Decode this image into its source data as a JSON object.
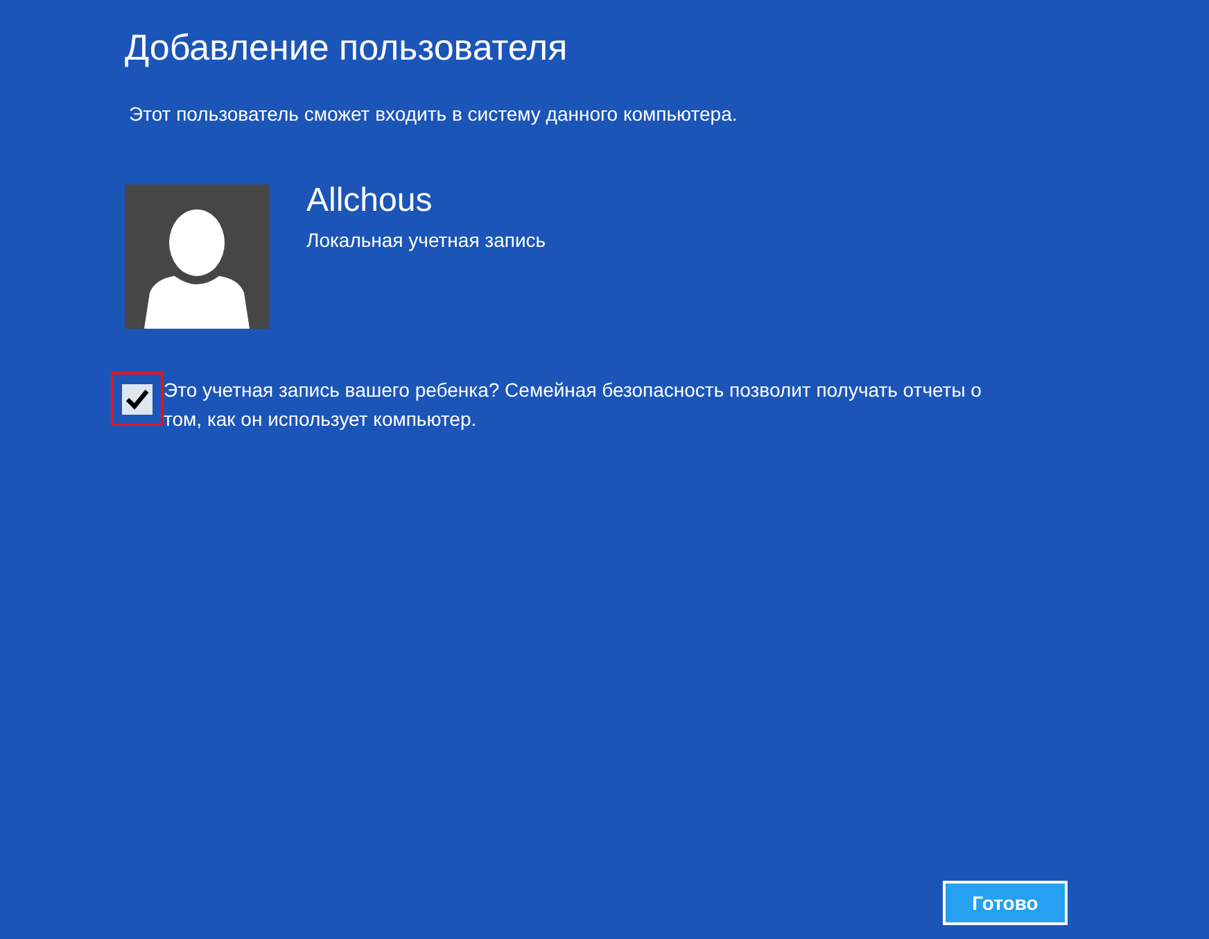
{
  "title": "Добавление пользователя",
  "subtitle": "Этот пользователь сможет входить в систему данного компьютера.",
  "account": {
    "name": "Allchous",
    "type": "Локальная учетная запись"
  },
  "child_account": {
    "label": "Это учетная запись вашего ребенка? Семейная безопасность позволит получать отчеты о том, как он использует компьютер.",
    "checked": true,
    "highlighted": true
  },
  "buttons": [
    {
      "label": "Готово"
    }
  ]
}
